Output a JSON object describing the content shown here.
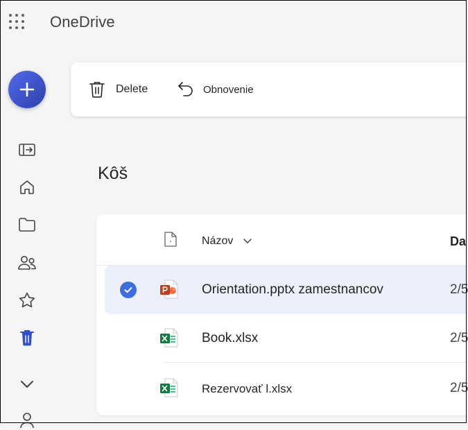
{
  "app": {
    "title": "OneDrive"
  },
  "command_bar": {
    "delete_label": "Delete",
    "restore_label": "Obnovenie"
  },
  "page": {
    "title": "Kôš"
  },
  "list": {
    "columns": {
      "name": "Názov",
      "date": "Da"
    },
    "rows": [
      {
        "name": "Orientation.pptx zamestnancov",
        "date": "2/5",
        "type": "pptx",
        "selected": true
      },
      {
        "name": "Book.xlsx",
        "date": "2/5",
        "type": "xlsx",
        "selected": false
      },
      {
        "name": "Rezervovať l.xlsx",
        "date": "2/5",
        "type": "xlsx",
        "selected": false
      }
    ]
  },
  "colors": {
    "accent": "#4f6bed",
    "selected_row": "#ebf0fb",
    "checkmark": "#3b6fe0",
    "powerpoint": "#c43e1c",
    "excel": "#107c41"
  }
}
